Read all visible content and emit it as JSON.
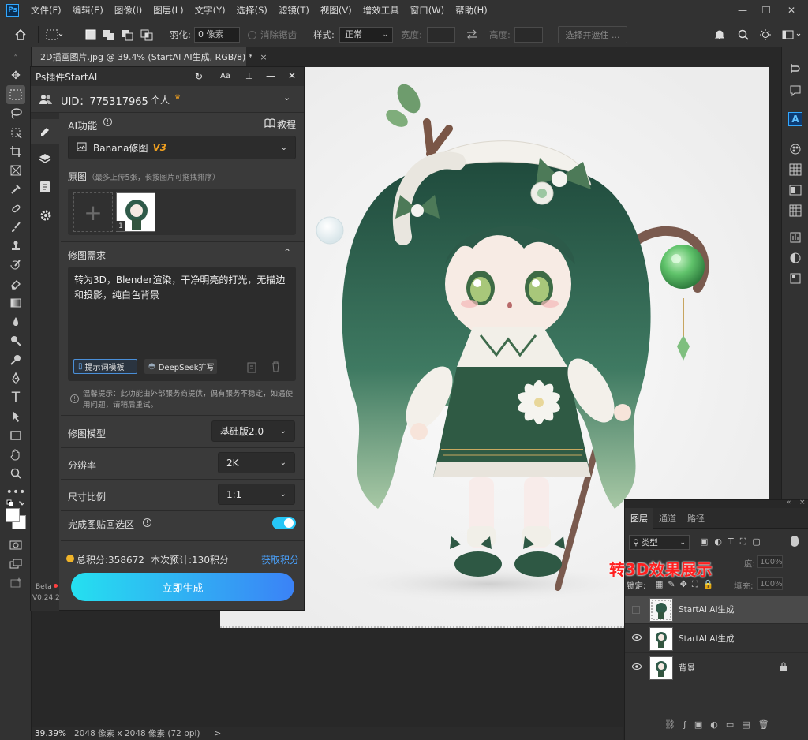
{
  "app": {
    "logo": "Ps",
    "menu": [
      "文件(F)",
      "编辑(E)",
      "图像(I)",
      "图层(L)",
      "文字(Y)",
      "选择(S)",
      "滤镜(T)",
      "视图(V)",
      "增效工具",
      "窗口(W)",
      "帮助(H)"
    ],
    "window_controls": [
      "—",
      "❐",
      "✕"
    ]
  },
  "options_bar": {
    "feather_label": "羽化:",
    "feather_value": "0 像素",
    "antialias_label": "消除锯齿",
    "style_label": "样式:",
    "style_value": "正常",
    "width_label": "宽度:",
    "height_label": "高度:",
    "select_mask_button": "选择并遮住 ..."
  },
  "document": {
    "tab_title": "2D插画图片.jpg @ 39.4% (StartAI AI生成, RGB/8) *",
    "tab_close": "×"
  },
  "plugin": {
    "title": "Ps插件StartAI",
    "header_icons": [
      "↻",
      "Aa",
      "⊥",
      "—",
      "✕"
    ],
    "uid_label": "UID：775317965",
    "account_type": "个人",
    "ai_function_label": "AI功能",
    "tutorial_label": "教程",
    "function_select": "Banana修图",
    "function_version": "V3",
    "source_label": "原图",
    "source_hint": "（最多上传5张，长按图片可拖拽排序）",
    "image_count_badge": "1",
    "requirement_label": "修图需求",
    "prompt_text": "转为3D，Blender渲染，干净明亮的打光，无描边和投影，纯白色背景",
    "template_button": "提示词模板",
    "deepseek_button": "DeepSeek扩写",
    "notice": "温馨提示：此功能由外部服务商提供，偶有服务不稳定，如遇使用问题，请稍后重试。",
    "model_label": "修图模型",
    "model_value": "基础版2.0",
    "resolution_label": "分辨率",
    "resolution_value": "2K",
    "ratio_label": "尺寸比例",
    "ratio_value": "1:1",
    "paste_back_label": "完成图贴回选区",
    "paste_back_on": true,
    "points_label": "总积分:358672",
    "estimate_label": "本次预计:130积分",
    "get_points_link": "获取积分",
    "generate_button": "立即生成",
    "beta_label": "Beta",
    "version_label": "V0.24.2"
  },
  "overlay_caption": "转3D效果展示",
  "layers_panel": {
    "tabs": [
      "图层",
      "通道",
      "路径"
    ],
    "filter_label": "类型",
    "opacity_partial": "度:",
    "opacity_value": "100%",
    "lock_label": "锁定:",
    "fill_label": "填充:",
    "fill_value": "100%",
    "layers": [
      {
        "name": "StartAI AI生成",
        "visible": false,
        "selected": true
      },
      {
        "name": "StartAI AI生成",
        "visible": true,
        "selected": false
      },
      {
        "name": "背景",
        "visible": true,
        "selected": false,
        "locked": true
      }
    ]
  },
  "status_bar": {
    "zoom": "39.39%",
    "doc_info": "2048 像素 x 2048 像素 (72 ppi)",
    "arrow": ">"
  },
  "colors": {
    "accent_blue": "#31a8ff",
    "toggle_on": "#26c6f6",
    "gradient_start": "#25e0f0",
    "gradient_end": "#3b82f6",
    "caption_red": "#ff2020",
    "points_link": "#4aa3ff",
    "version_tag": "#f0a020"
  }
}
